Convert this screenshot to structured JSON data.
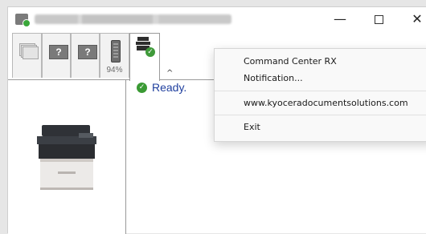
{
  "window": {
    "title_icon": "printer-status-icon",
    "controls": {
      "minimize": "—",
      "maximize": "□",
      "close": "✕"
    }
  },
  "toolbar": {
    "tabs": [
      {
        "name": "paper-tray",
        "icon": "paper-stack-icon"
      },
      {
        "name": "unknown-1",
        "icon": "question-icon",
        "glyph": "?"
      },
      {
        "name": "unknown-2",
        "icon": "question-icon",
        "glyph": "?"
      },
      {
        "name": "toner",
        "icon": "toner-icon",
        "level_text": "94%",
        "level": 0.94
      },
      {
        "name": "status",
        "icon": "printer-check-icon"
      }
    ],
    "collapse_glyph": "^",
    "gear_glyph": "⚙"
  },
  "status": {
    "text": "Ready.",
    "check_glyph": "✓"
  },
  "context_menu": {
    "items": [
      "Command Center RX",
      "Notification...",
      "www.kyoceradocumentsolutions.com",
      "Exit"
    ]
  },
  "colors": {
    "ready_text": "#1f3f9e",
    "ok_green": "#3a9a34"
  }
}
